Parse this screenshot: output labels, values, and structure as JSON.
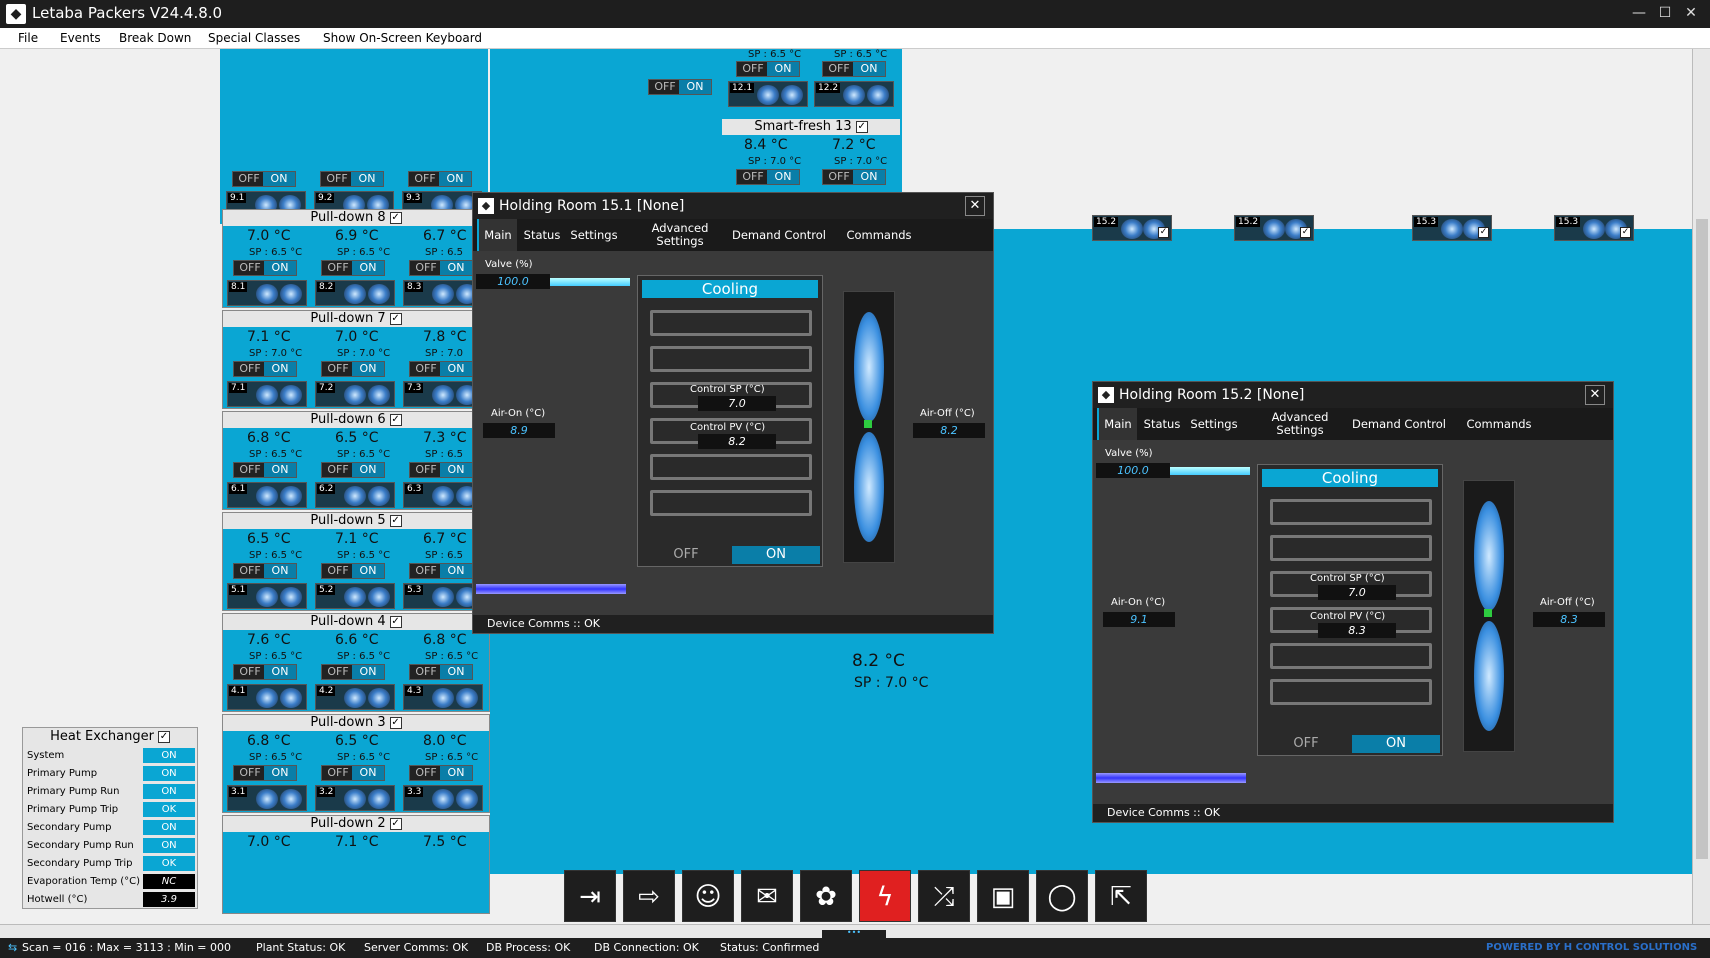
{
  "app": {
    "title": "Letaba Packers V24.4.8.0"
  },
  "menu": [
    "File",
    "Events",
    "Break Down",
    "Special Classes",
    "Show On-Screen Keyboard"
  ],
  "top_row": {
    "fans": [
      "9.1",
      "9.2",
      "9.3"
    ]
  },
  "pulldowns": [
    {
      "name": "Pull-down 8",
      "temps": [
        "7.0 °C",
        "6.9 °C",
        "6.7 °C"
      ],
      "sps": [
        "SP : 6.5 °C",
        "SP : 6.5 °C",
        "SP : 6.5"
      ],
      "fans": [
        "8.1",
        "8.2",
        "8.3"
      ]
    },
    {
      "name": "Pull-down 7",
      "temps": [
        "7.1 °C",
        "7.0 °C",
        "7.8 °C"
      ],
      "sps": [
        "SP : 7.0 °C",
        "SP : 7.0 °C",
        "SP : 7.0"
      ],
      "fans": [
        "7.1",
        "7.2",
        "7.3"
      ]
    },
    {
      "name": "Pull-down 6",
      "temps": [
        "6.8 °C",
        "6.5 °C",
        "7.3 °C"
      ],
      "sps": [
        "SP : 6.5 °C",
        "SP : 6.5 °C",
        "SP : 6.5"
      ],
      "fans": [
        "6.1",
        "6.2",
        "6.3"
      ]
    },
    {
      "name": "Pull-down 5",
      "temps": [
        "6.5 °C",
        "7.1 °C",
        "6.7 °C"
      ],
      "sps": [
        "SP : 6.5 °C",
        "SP : 6.5 °C",
        "SP : 6.5"
      ],
      "fans": [
        "5.1",
        "5.2",
        "5.3"
      ]
    },
    {
      "name": "Pull-down 4",
      "temps": [
        "7.6 °C",
        "6.6 °C",
        "6.8 °C"
      ],
      "sps": [
        "SP : 6.5 °C",
        "SP : 6.5 °C",
        "SP : 6.5 °C"
      ],
      "fans": [
        "4.1",
        "4.2",
        "4.3"
      ]
    },
    {
      "name": "Pull-down 3",
      "temps": [
        "6.8 °C",
        "6.5 °C",
        "8.0 °C"
      ],
      "sps": [
        "SP : 6.5 °C",
        "SP : 6.5 °C",
        "SP : 6.5 °C"
      ],
      "fans": [
        "3.1",
        "3.2",
        "3.3"
      ]
    },
    {
      "name": "Pull-down 2",
      "temps": [
        "7.0 °C",
        "7.1 °C",
        "7.5 °C"
      ],
      "sps": [
        "",
        "",
        ""
      ],
      "fans": []
    }
  ],
  "toggle": {
    "off": "OFF",
    "on": "ON"
  },
  "smartfresh": {
    "top_sps": [
      "SP : 6.5 °C",
      "SP : 6.5 °C"
    ],
    "top_fans": [
      "12.1",
      "12.2"
    ],
    "name": "Smart-fresh 13",
    "temps": [
      "8.4 °C",
      "7.2 °C"
    ],
    "sps": [
      "SP : 7.0 °C",
      "SP : 7.0 °C"
    ]
  },
  "room15_fans": [
    "15.2",
    "15.2",
    "15.3",
    "15.3"
  ],
  "center_reading": {
    "temp": "8.2 °C",
    "sp": "SP : 7.0 °C"
  },
  "heat_exchanger": {
    "title": "Heat Exchanger",
    "rows": [
      {
        "label": "System",
        "value": "ON"
      },
      {
        "label": "Primary Pump",
        "value": "ON"
      },
      {
        "label": "Primary Pump Run",
        "value": "ON"
      },
      {
        "label": "Primary Pump Trip",
        "value": "OK"
      },
      {
        "label": "Secondary Pump",
        "value": "ON"
      },
      {
        "label": "Secondary Pump Run",
        "value": "ON"
      },
      {
        "label": "Secondary Pump Trip",
        "value": "OK"
      },
      {
        "label": "Evaporation Temp (°C)",
        "value": "NC"
      },
      {
        "label": "Hotwell (°C)",
        "value": "3.9"
      }
    ]
  },
  "dialog1": {
    "title": "Holding Room 15.1 [None]",
    "tabs": [
      "Main",
      "Status",
      "Settings",
      "Advanced Settings",
      "Demand Control",
      "Commands"
    ],
    "valve_label": "Valve (%)",
    "valve": "100.0",
    "mode": "Cooling",
    "air_on_label": "Air-On (°C)",
    "air_on": "8.9",
    "air_off_label": "Air-Off (°C)",
    "air_off": "8.2",
    "sp_label": "Control SP (°C)",
    "sp": "7.0",
    "pv_label": "Control PV (°C)",
    "pv": "8.2",
    "off": "OFF",
    "on": "ON",
    "footer": "Device Comms :: OK"
  },
  "dialog2": {
    "title": "Holding Room 15.2 [None]",
    "tabs": [
      "Main",
      "Status",
      "Settings",
      "Advanced Settings",
      "Demand Control",
      "Commands"
    ],
    "valve_label": "Valve (%)",
    "valve": "100.0",
    "mode": "Cooling",
    "air_on_label": "Air-On (°C)",
    "air_on": "9.1",
    "air_off_label": "Air-Off (°C)",
    "air_off": "8.3",
    "sp_label": "Control SP (°C)",
    "sp": "7.0",
    "pv_label": "Control PV (°C)",
    "pv": "8.3",
    "off": "OFF",
    "on": "ON",
    "footer": "Device Comms :: OK"
  },
  "toolbar": {
    "icons": [
      "login-icon",
      "logout-icon",
      "user-settings-icon",
      "mail-icon",
      "plant-icon",
      "alarm-bolt-icon",
      "shuffle-icon",
      "save-icon",
      "refresh-icon",
      "external-link-icon"
    ],
    "glyphs": [
      "⇥",
      "⇨",
      "☺",
      "✉",
      "✿",
      "ϟ",
      "⤮",
      "▣",
      "◯",
      "⇱"
    ]
  },
  "status": {
    "scan": "Scan = 016 : Max = 3113 : Min = 000",
    "plant": "Plant Status: OK",
    "server": "Server Comms: OK",
    "db_process": "DB Process:  OK",
    "db_conn": "DB Connection:  OK",
    "state": "Status:  Confirmed",
    "brand": "POWERED BY H CONTROL SOLUTIONS"
  },
  "colors": {
    "accent": "#0aa6d3",
    "alarm": "#e02020",
    "brand": "#2a6fc9"
  }
}
